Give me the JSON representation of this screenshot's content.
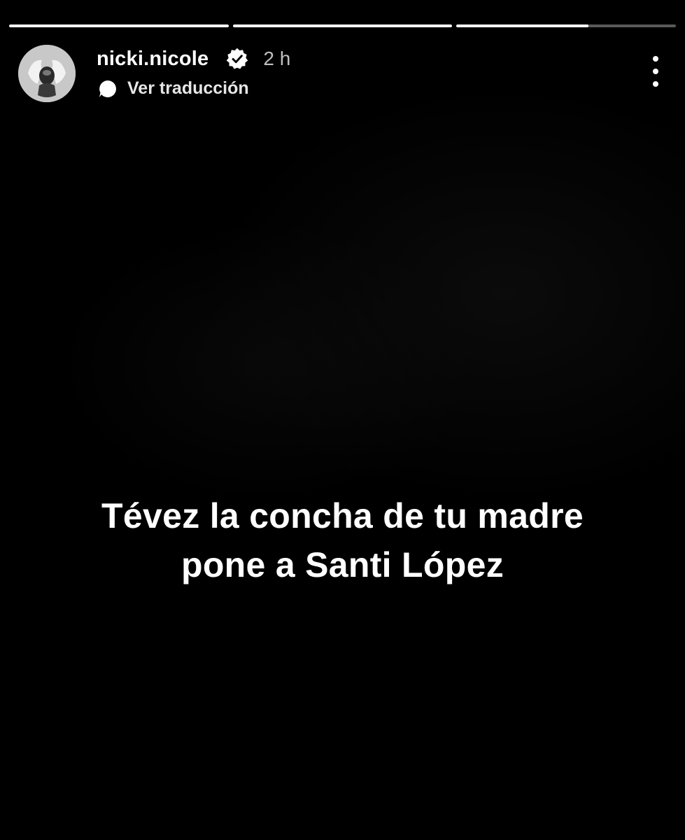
{
  "story": {
    "progress": [
      {
        "fill": 1.0
      },
      {
        "fill": 1.0
      },
      {
        "fill": 0.6
      }
    ]
  },
  "header": {
    "username": "nicki.nicole",
    "verified": true,
    "time": "2 h",
    "translate_label": "Ver traducción"
  },
  "caption": {
    "line1": "Tévez la concha de tu madre",
    "line2": "pone a Santi López"
  },
  "colors": {
    "background": "#000000",
    "text": "#ffffff",
    "time": "#bfbfbf"
  },
  "icons": {
    "verified": "verified-badge-icon",
    "translate": "chat-bubble-icon",
    "more": "more-vertical-icon"
  }
}
